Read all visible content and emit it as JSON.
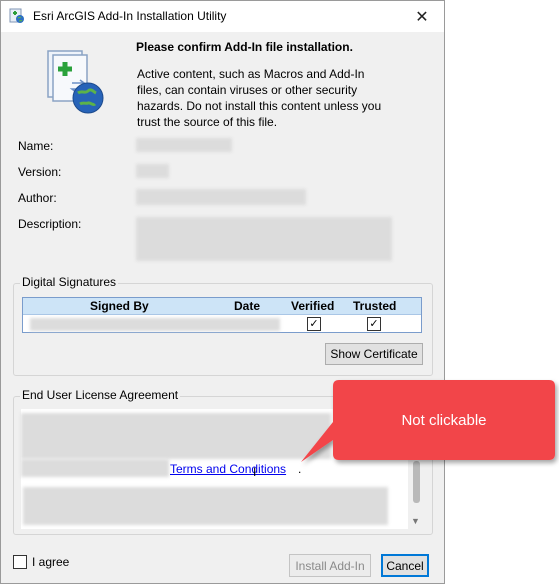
{
  "window": {
    "title": "Esri ArcGIS Add-In Installation Utility",
    "close_glyph": "✕",
    "app_icon": "arcgis-addin-icon"
  },
  "header": {
    "confirm_text": "Please confirm Add-In file installation.",
    "warning_lines": [
      "Active content, such as Macros and Add-In",
      "files, can  contain viruses or other security",
      "hazards.  Do not install this content unless you",
      "trust the  source of this file."
    ],
    "icon": "addin-install-icon"
  },
  "properties": {
    "name_label": "Name:",
    "version_label": "Version:",
    "author_label": "Author:",
    "description_label": "Description:"
  },
  "digital_signatures": {
    "legend": "Digital Signatures",
    "columns": [
      "Signed By",
      "Date",
      "Verified",
      "Trusted"
    ],
    "verified_checked": true,
    "trusted_checked": true,
    "check_glyph": "✓",
    "show_certificate_label": "Show Certificate"
  },
  "eula": {
    "legend": "End User License Agreement",
    "link_text": "Terms and Conditions",
    "link_suffix": ".",
    "scroll_up_glyph": "▲",
    "scroll_down_glyph": "▼"
  },
  "footer": {
    "agree_label": "I agree",
    "agree_checked": false,
    "install_label": "Install Add-In",
    "install_enabled": false,
    "cancel_label": "Cancel"
  },
  "annotation": {
    "text": "Not clickable",
    "color": "#f2454a"
  },
  "cursor_glyph": "I"
}
